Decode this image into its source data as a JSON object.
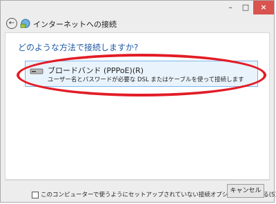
{
  "window": {
    "title": "インターネットへの接続",
    "minimize_glyph": "–",
    "maximize_glyph": "□",
    "close_glyph": "×"
  },
  "back": {
    "glyph": "←"
  },
  "main": {
    "question": "どのような方法で接続しますか?",
    "option": {
      "title": "ブロードバンド (PPPoE)(R)",
      "description": "ユーザー名とパスワードが必要な DSL またはケーブルを使って接続します"
    },
    "checkbox_label": "このコンピューターで使うようにセットアップされていない接続オプションを表示する(S)"
  },
  "footer": {
    "cancel_label": "キャンセル"
  },
  "colors": {
    "accent": "#1f5aa6",
    "highlight": "#e21c26",
    "selection_bg": "#e9f3fc",
    "selection_border": "#7eb4ea",
    "close_bg": "#d9534f"
  }
}
